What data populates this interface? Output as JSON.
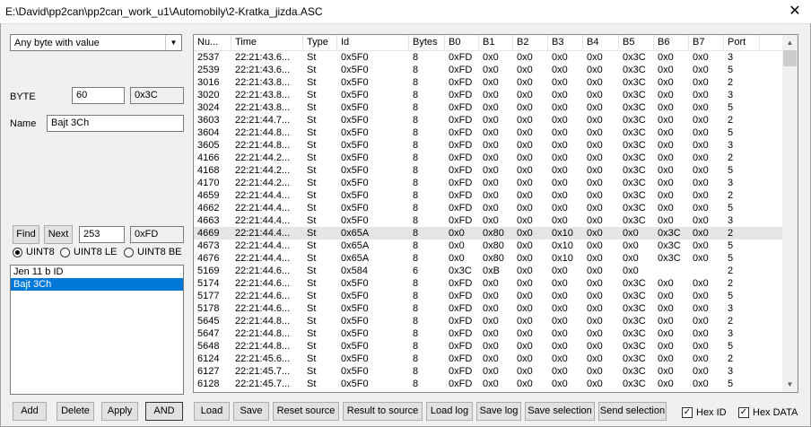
{
  "window": {
    "title": "E:\\David\\pp2can\\pp2can_work_u1\\Automobily\\2-Kratka_jizda.ASC",
    "close_glyph": "✕"
  },
  "filter": {
    "mode": "Any byte with value"
  },
  "byte": {
    "label": "BYTE",
    "value": "60",
    "hex": "0x3C"
  },
  "name": {
    "label": "Name",
    "value": "Bajt 3Ch"
  },
  "find": {
    "find_label": "Find",
    "next_label": "Next",
    "value": "253",
    "hex": "0xFD"
  },
  "types": [
    "UINT8",
    "UINT8 LE",
    "UINT8 BE"
  ],
  "selected_type": "UINT8",
  "filters_list": {
    "items": [
      "Jen 11 b ID",
      "Bajt 3Ch"
    ],
    "selected_index": 1
  },
  "left_buttons": {
    "add": "Add",
    "delete": "Delete",
    "apply": "Apply",
    "and": "AND"
  },
  "table": {
    "columns": [
      "Nu...",
      "Time",
      "Type",
      "Id",
      "Bytes",
      "B0",
      "B1",
      "B2",
      "B3",
      "B4",
      "B5",
      "B6",
      "B7",
      "Port"
    ],
    "rows": [
      [
        "2537",
        "22:21:43.6...",
        "St",
        "0x5F0",
        "8",
        "0xFD",
        "0x0",
        "0x0",
        "0x0",
        "0x0",
        "0x3C",
        "0x0",
        "0x0",
        "3"
      ],
      [
        "2539",
        "22:21:43.6...",
        "St",
        "0x5F0",
        "8",
        "0xFD",
        "0x0",
        "0x0",
        "0x0",
        "0x0",
        "0x3C",
        "0x0",
        "0x0",
        "5"
      ],
      [
        "3016",
        "22:21:43.8...",
        "St",
        "0x5F0",
        "8",
        "0xFD",
        "0x0",
        "0x0",
        "0x0",
        "0x0",
        "0x3C",
        "0x0",
        "0x0",
        "2"
      ],
      [
        "3020",
        "22:21:43.8...",
        "St",
        "0x5F0",
        "8",
        "0xFD",
        "0x0",
        "0x0",
        "0x0",
        "0x0",
        "0x3C",
        "0x0",
        "0x0",
        "3"
      ],
      [
        "3024",
        "22:21:43.8...",
        "St",
        "0x5F0",
        "8",
        "0xFD",
        "0x0",
        "0x0",
        "0x0",
        "0x0",
        "0x3C",
        "0x0",
        "0x0",
        "5"
      ],
      [
        "3603",
        "22:21:44.7...",
        "St",
        "0x5F0",
        "8",
        "0xFD",
        "0x0",
        "0x0",
        "0x0",
        "0x0",
        "0x3C",
        "0x0",
        "0x0",
        "2"
      ],
      [
        "3604",
        "22:21:44.8...",
        "St",
        "0x5F0",
        "8",
        "0xFD",
        "0x0",
        "0x0",
        "0x0",
        "0x0",
        "0x3C",
        "0x0",
        "0x0",
        "5"
      ],
      [
        "3605",
        "22:21:44.8...",
        "St",
        "0x5F0",
        "8",
        "0xFD",
        "0x0",
        "0x0",
        "0x0",
        "0x0",
        "0x3C",
        "0x0",
        "0x0",
        "3"
      ],
      [
        "4166",
        "22:21:44.2...",
        "St",
        "0x5F0",
        "8",
        "0xFD",
        "0x0",
        "0x0",
        "0x0",
        "0x0",
        "0x3C",
        "0x0",
        "0x0",
        "2"
      ],
      [
        "4168",
        "22:21:44.2...",
        "St",
        "0x5F0",
        "8",
        "0xFD",
        "0x0",
        "0x0",
        "0x0",
        "0x0",
        "0x3C",
        "0x0",
        "0x0",
        "5"
      ],
      [
        "4170",
        "22:21:44.2...",
        "St",
        "0x5F0",
        "8",
        "0xFD",
        "0x0",
        "0x0",
        "0x0",
        "0x0",
        "0x3C",
        "0x0",
        "0x0",
        "3"
      ],
      [
        "4659",
        "22:21:44.4...",
        "St",
        "0x5F0",
        "8",
        "0xFD",
        "0x0",
        "0x0",
        "0x0",
        "0x0",
        "0x3C",
        "0x0",
        "0x0",
        "2"
      ],
      [
        "4662",
        "22:21:44.4...",
        "St",
        "0x5F0",
        "8",
        "0xFD",
        "0x0",
        "0x0",
        "0x0",
        "0x0",
        "0x3C",
        "0x0",
        "0x0",
        "5"
      ],
      [
        "4663",
        "22:21:44.4...",
        "St",
        "0x5F0",
        "8",
        "0xFD",
        "0x0",
        "0x0",
        "0x0",
        "0x0",
        "0x3C",
        "0x0",
        "0x0",
        "3"
      ],
      [
        "4669",
        "22:21:44.4...",
        "St",
        "0x65A",
        "8",
        "0x0",
        "0x80",
        "0x0",
        "0x10",
        "0x0",
        "0x0",
        "0x3C",
        "0x0",
        "2"
      ],
      [
        "4673",
        "22:21:44.4...",
        "St",
        "0x65A",
        "8",
        "0x0",
        "0x80",
        "0x0",
        "0x10",
        "0x0",
        "0x0",
        "0x3C",
        "0x0",
        "5"
      ],
      [
        "4676",
        "22:21:44.4...",
        "St",
        "0x65A",
        "8",
        "0x0",
        "0x80",
        "0x0",
        "0x10",
        "0x0",
        "0x0",
        "0x3C",
        "0x0",
        "5"
      ],
      [
        "5169",
        "22:21:44.6...",
        "St",
        "0x584",
        "6",
        "0x3C",
        "0xB",
        "0x0",
        "0x0",
        "0x0",
        "0x0",
        "",
        "",
        "2"
      ],
      [
        "5174",
        "22:21:44.6...",
        "St",
        "0x5F0",
        "8",
        "0xFD",
        "0x0",
        "0x0",
        "0x0",
        "0x0",
        "0x3C",
        "0x0",
        "0x0",
        "2"
      ],
      [
        "5177",
        "22:21:44.6...",
        "St",
        "0x5F0",
        "8",
        "0xFD",
        "0x0",
        "0x0",
        "0x0",
        "0x0",
        "0x3C",
        "0x0",
        "0x0",
        "5"
      ],
      [
        "5178",
        "22:21:44.6...",
        "St",
        "0x5F0",
        "8",
        "0xFD",
        "0x0",
        "0x0",
        "0x0",
        "0x0",
        "0x3C",
        "0x0",
        "0x0",
        "3"
      ],
      [
        "5645",
        "22:21:44.8...",
        "St",
        "0x5F0",
        "8",
        "0xFD",
        "0x0",
        "0x0",
        "0x0",
        "0x0",
        "0x3C",
        "0x0",
        "0x0",
        "2"
      ],
      [
        "5647",
        "22:21:44.8...",
        "St",
        "0x5F0",
        "8",
        "0xFD",
        "0x0",
        "0x0",
        "0x0",
        "0x0",
        "0x3C",
        "0x0",
        "0x0",
        "3"
      ],
      [
        "5648",
        "22:21:44.8...",
        "St",
        "0x5F0",
        "8",
        "0xFD",
        "0x0",
        "0x0",
        "0x0",
        "0x0",
        "0x3C",
        "0x0",
        "0x0",
        "5"
      ],
      [
        "6124",
        "22:21:45.6...",
        "St",
        "0x5F0",
        "8",
        "0xFD",
        "0x0",
        "0x0",
        "0x0",
        "0x0",
        "0x3C",
        "0x0",
        "0x0",
        "2"
      ],
      [
        "6127",
        "22:21:45.7...",
        "St",
        "0x5F0",
        "8",
        "0xFD",
        "0x0",
        "0x0",
        "0x0",
        "0x0",
        "0x3C",
        "0x0",
        "0x0",
        "3"
      ],
      [
        "6128",
        "22:21:45.7...",
        "St",
        "0x5F0",
        "8",
        "0xFD",
        "0x0",
        "0x0",
        "0x0",
        "0x0",
        "0x3C",
        "0x0",
        "0x0",
        "5"
      ]
    ],
    "highlight_index": 14
  },
  "bottom_buttons": {
    "load": "Load",
    "save": "Save",
    "reset_source": "Reset source",
    "result_to_source": "Result to source",
    "load_log": "Load log",
    "save_log": "Save log",
    "save_selection": "Save selection",
    "send_selection": "Send selection"
  },
  "checks": {
    "hex_id": "Hex ID",
    "hex_data": "Hex DATA",
    "hex_id_checked": true,
    "hex_data_checked": true
  },
  "colors": {
    "selection": "#0078d7",
    "row_highlight": "#e5e5e5"
  }
}
